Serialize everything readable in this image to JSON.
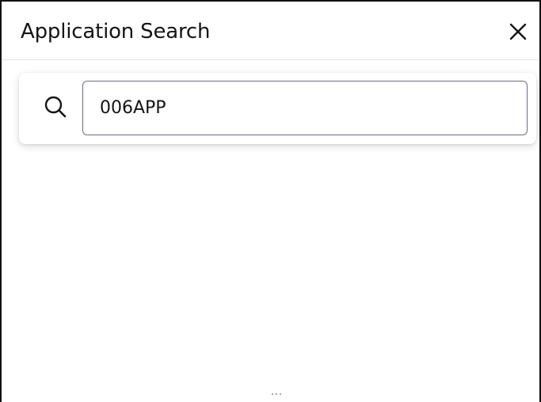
{
  "dialog": {
    "title": "Application Search",
    "close_icon": "close-icon"
  },
  "search": {
    "icon": "search-icon",
    "value": "006APP",
    "placeholder": ""
  },
  "footer": {
    "resize_icon": "resize-grip-icon"
  },
  "colors": {
    "title_text": "#161513",
    "input_border": "#6a6f80",
    "frame_border": "#111111"
  }
}
